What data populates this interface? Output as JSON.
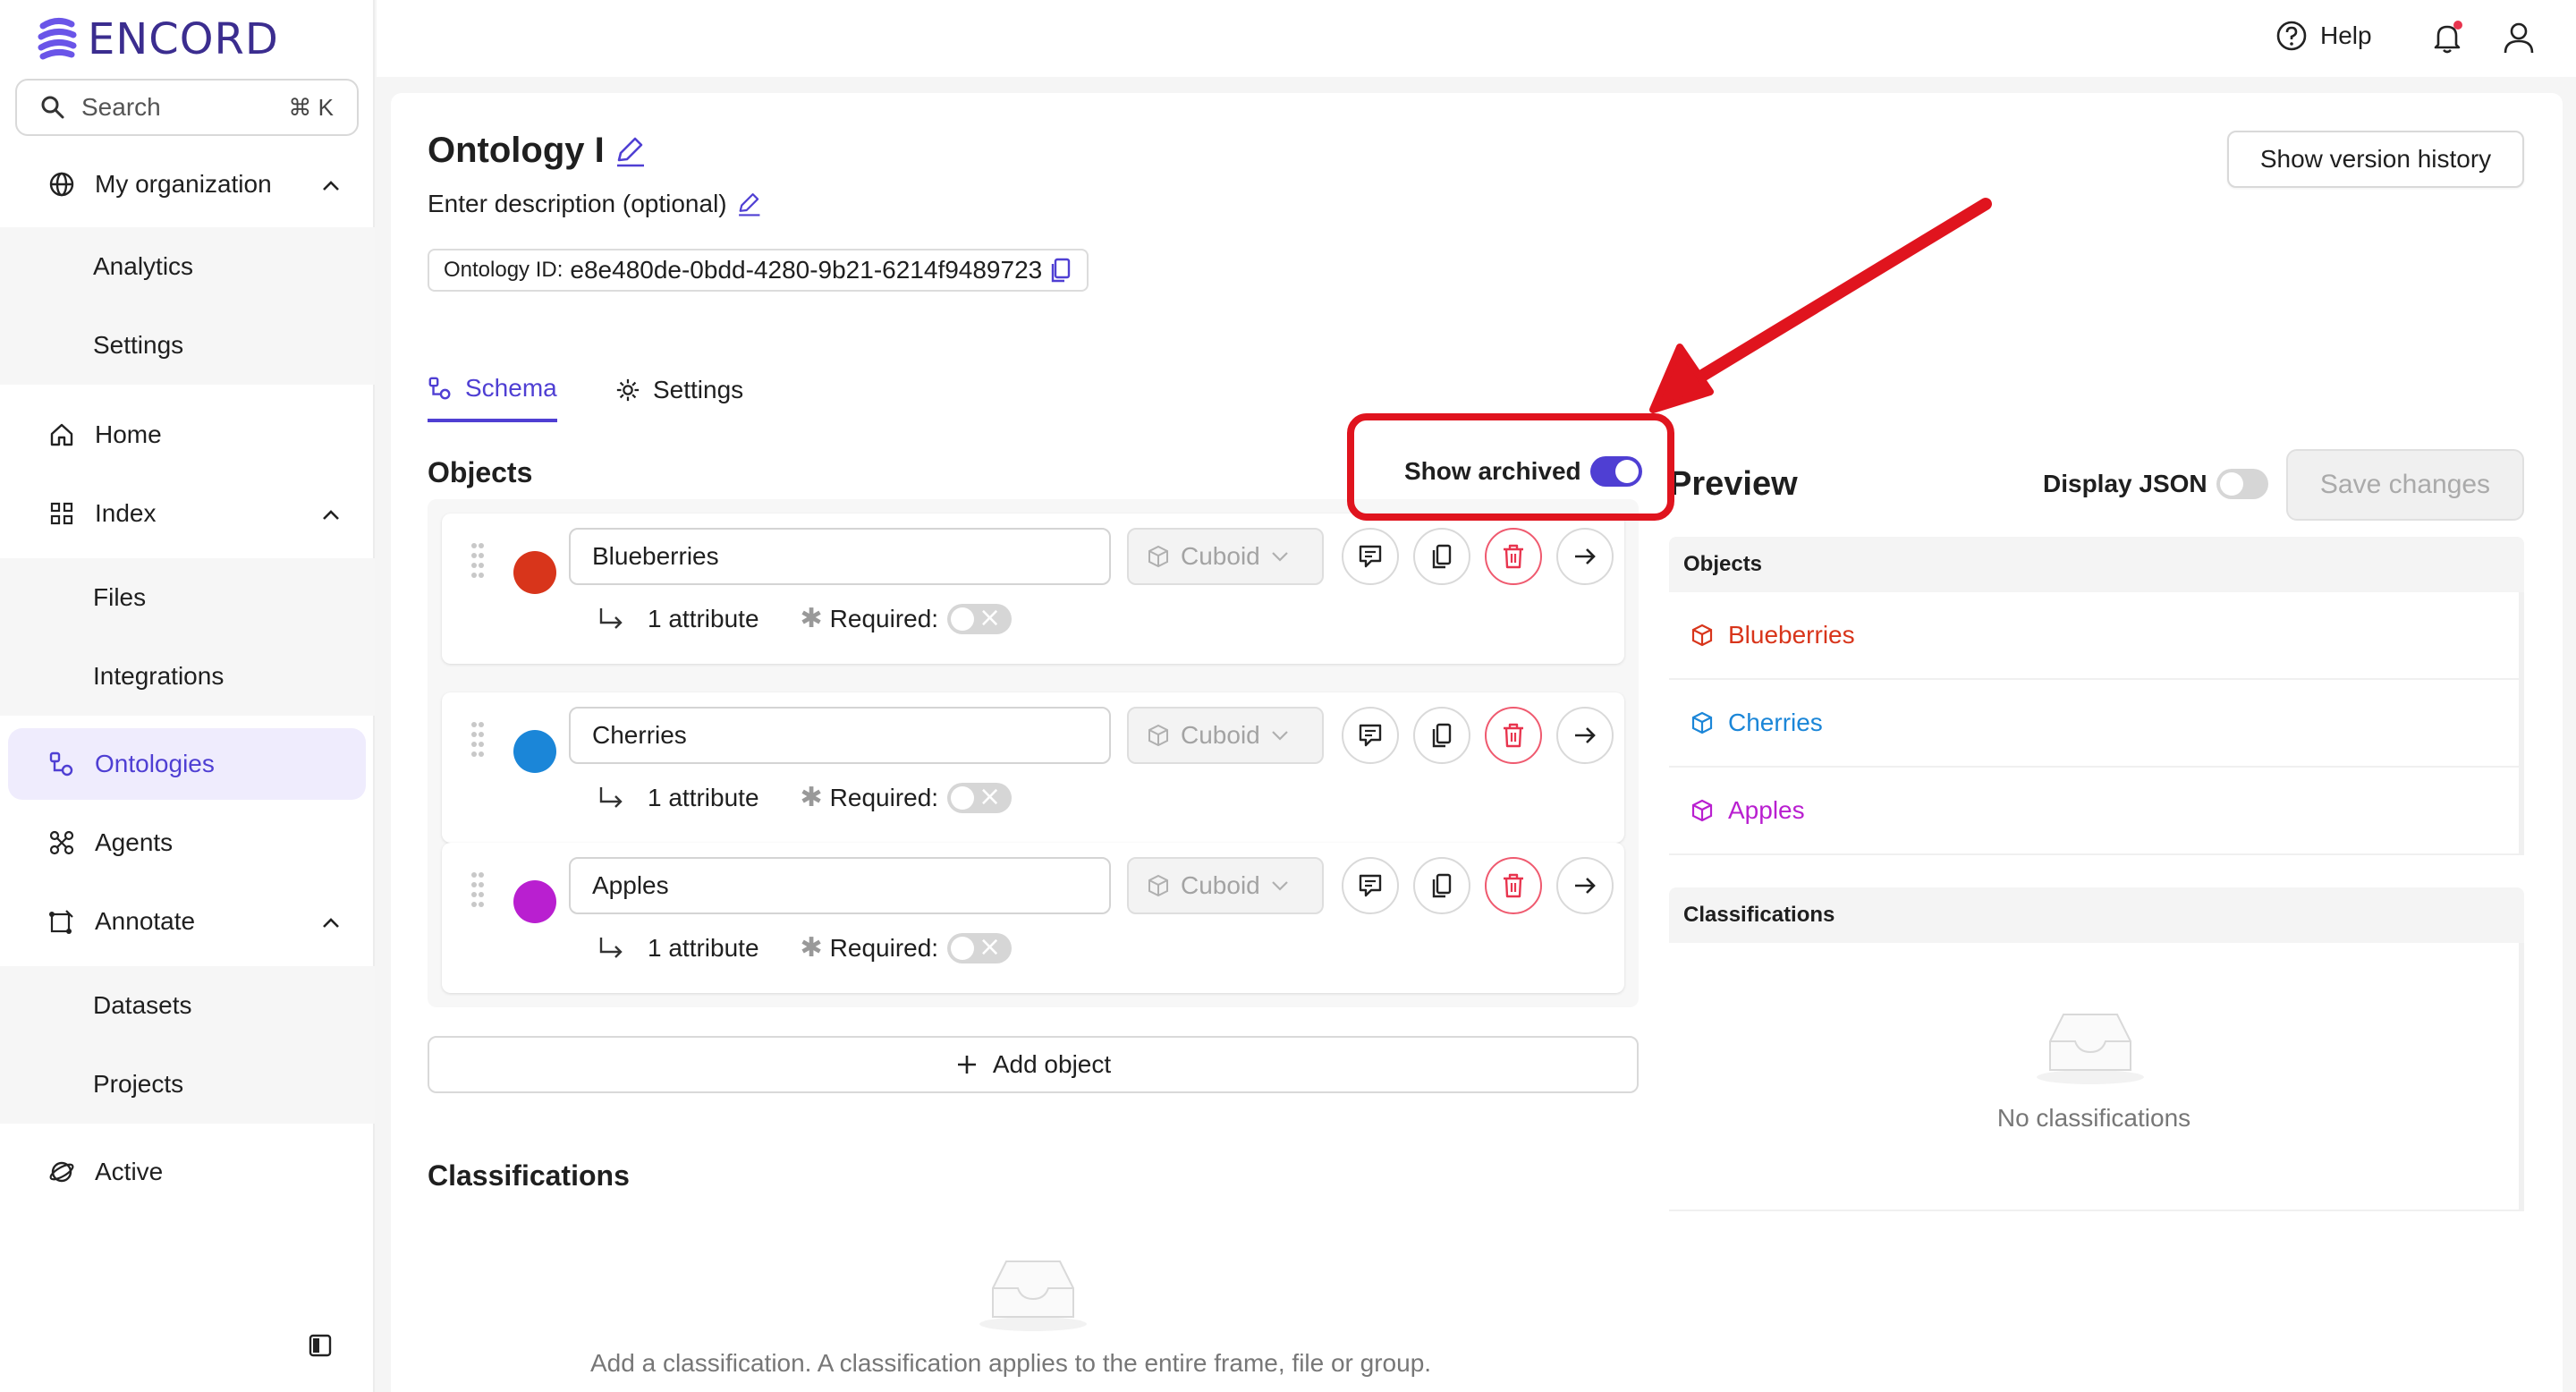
{
  "app": {
    "brand": "ENCORD",
    "accent": "#4f3fd3"
  },
  "search": {
    "label": "Search",
    "shortcut": "⌘ K"
  },
  "sidebar": {
    "org": "My organization",
    "org_sub": [
      "Analytics",
      "Settings"
    ],
    "home": "Home",
    "index": "Index",
    "index_sub": [
      "Files",
      "Integrations"
    ],
    "ontologies": "Ontologies",
    "agents": "Agents",
    "annotate": "Annotate",
    "annotate_sub": [
      "Datasets",
      "Projects"
    ],
    "active": "Active"
  },
  "topbar": {
    "help": "Help"
  },
  "ontology": {
    "title": "Ontology I",
    "description": "Enter description (optional)",
    "id_label": "Ontology ID:",
    "id_value": "e8e480de-0bdd-4280-9b21-6214f9489723",
    "version_history": "Show version history"
  },
  "tabs": {
    "schema": "Schema",
    "settings": "Settings"
  },
  "objects_section": {
    "title": "Objects",
    "show_archived": "Show archived",
    "show_archived_on": true,
    "add_object": "Add object",
    "items": [
      {
        "name": "Blueberries",
        "color": "#d8351b",
        "shape": "Cuboid",
        "attributes": "1 attribute",
        "required_label": "Required:"
      },
      {
        "name": "Cherries",
        "color": "#1b86d8",
        "shape": "Cuboid",
        "attributes": "1 attribute",
        "required_label": "Required:"
      },
      {
        "name": "Apples",
        "color": "#b91fd0",
        "shape": "Cuboid",
        "attributes": "1 attribute",
        "required_label": "Required:"
      }
    ]
  },
  "classifications_section": {
    "title": "Classifications",
    "hint": "Add a classification. A classification applies to the entire frame, file or group."
  },
  "preview": {
    "title": "Preview",
    "display_json": "Display JSON",
    "save_changes": "Save changes",
    "objects_head": "Objects",
    "classifications_head": "Classifications",
    "no_classifications": "No classifications"
  }
}
